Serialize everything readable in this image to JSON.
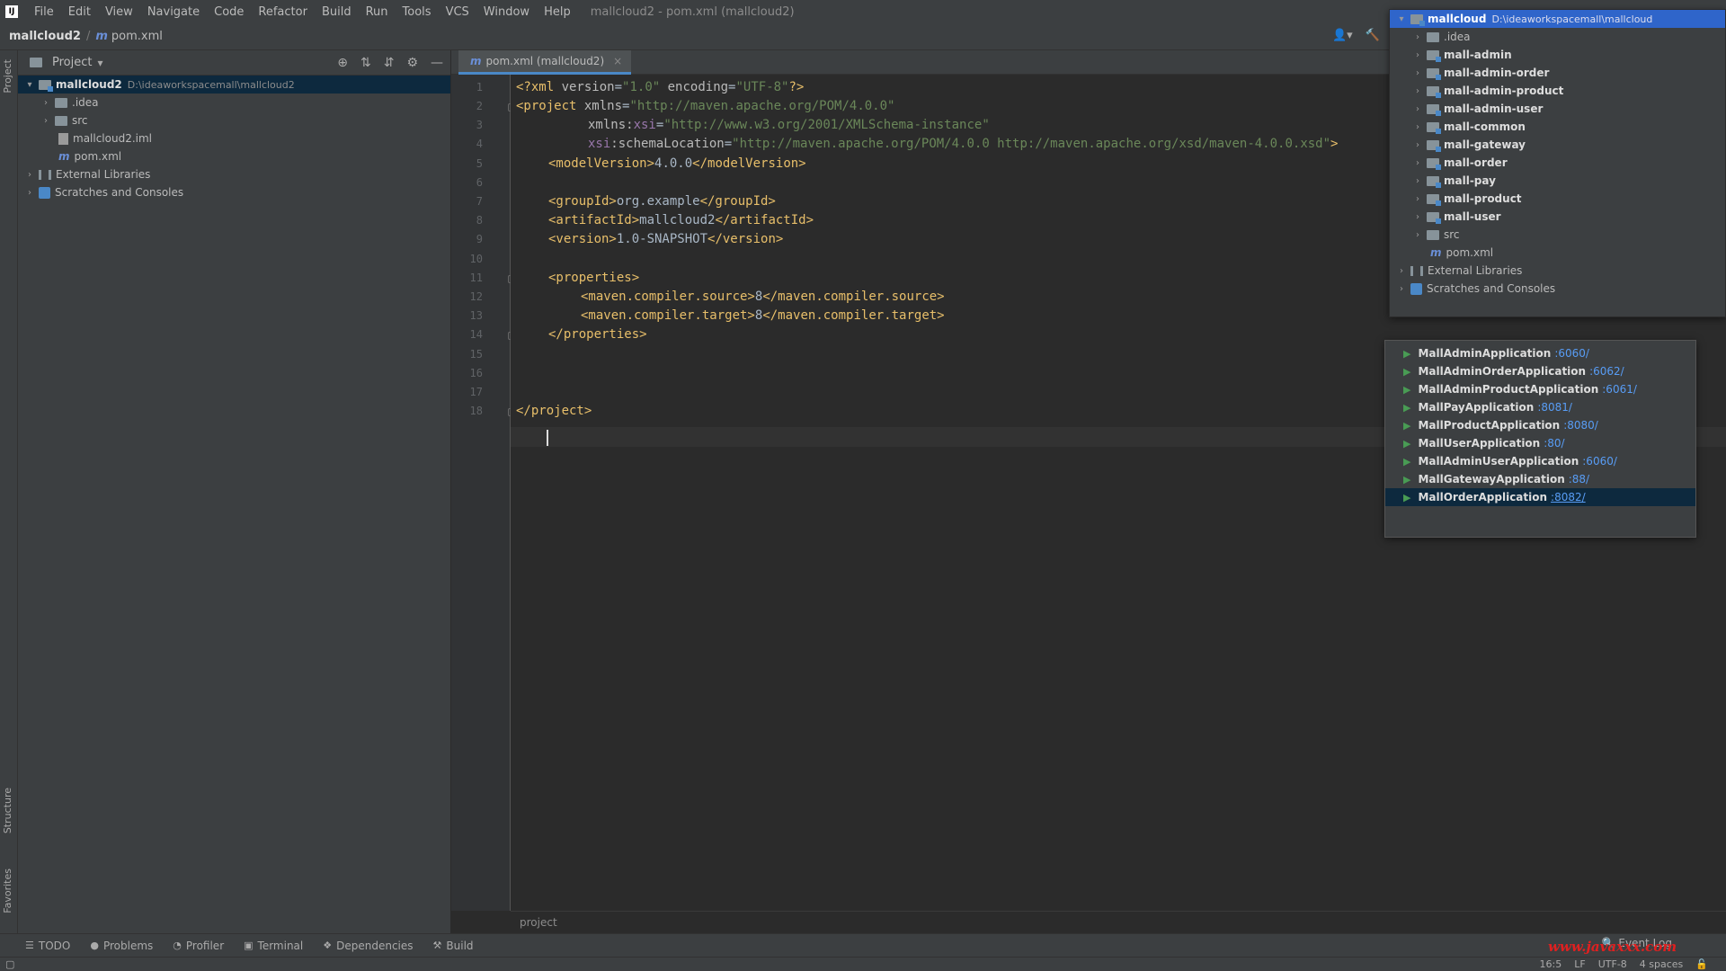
{
  "menubar": {
    "logo": "IJ",
    "items": [
      "File",
      "Edit",
      "View",
      "Navigate",
      "Code",
      "Refactor",
      "Build",
      "Run",
      "Tools",
      "VCS",
      "Window",
      "Help"
    ],
    "title": "mallcloud2 - pom.xml (mallcloud2)"
  },
  "navbar": {
    "project": "mallcloud2",
    "sep": "/",
    "file_icon": "m",
    "file": "pom.xml"
  },
  "left_strip": {
    "project": "Project",
    "structure": "Structure",
    "favorites": "Favorites"
  },
  "project_panel": {
    "title": "Project",
    "dropdown": "▾",
    "tree": [
      {
        "label": "mallcloud2",
        "hint": "D:\\ideaworkspacemall\\mallcloud2"
      },
      {
        "label": ".idea"
      },
      {
        "label": "src"
      },
      {
        "label": "mallcloud2.iml"
      },
      {
        "label": "pom.xml"
      },
      {
        "label": "External Libraries"
      },
      {
        "label": "Scratches and Consoles"
      }
    ]
  },
  "editor": {
    "tab_label": "pom.xml (mallcloud2)",
    "tab_close": "×",
    "line_numbers": [
      "1",
      "2",
      "3",
      "4",
      "5",
      "6",
      "7",
      "8",
      "9",
      "10",
      "11",
      "12",
      "13",
      "14",
      "15",
      "16",
      "17",
      "18"
    ],
    "lines": {
      "l1": {
        "a": "<?xml ",
        "b": "version",
        "c": "=",
        "d": "\"1.0\"",
        "e": " encoding",
        "f": "=",
        "g": "\"UTF-8\"",
        "h": "?>"
      },
      "l2": {
        "a": "<project ",
        "b": "xmlns",
        "c": "=",
        "d": "\"http://maven.apache.org/POM/4.0.0\""
      },
      "l3": {
        "a": "xmlns:",
        "b": "xsi",
        "c": "=",
        "d": "\"http://www.w3.org/2001/XMLSchema-instance\""
      },
      "l4": {
        "a": "xsi",
        "b": ":schemaLocation",
        "c": "=",
        "d": "\"http://maven.apache.org/POM/4.0.0 http://maven.apache.org/xsd/maven-4.0.0.xsd\"",
        "e": ">"
      },
      "l5": {
        "a": "<modelVersion>",
        "b": "4.0.0",
        "c": "</modelVersion>"
      },
      "l7": {
        "a": "<groupId>",
        "b": "org.example",
        "c": "</groupId>"
      },
      "l8": {
        "a": "<artifactId>",
        "b": "mallcloud2",
        "c": "</artifactId>"
      },
      "l9": {
        "a": "<version>",
        "b": "1.0-SNAPSHOT",
        "c": "</version>"
      },
      "l11": {
        "a": "<properties>"
      },
      "l12": {
        "a": "<maven.compiler.source>",
        "b": "8",
        "c": "</maven.compiler.source>"
      },
      "l13": {
        "a": "<maven.compiler.target>",
        "b": "8",
        "c": "</maven.compiler.target>"
      },
      "l14": {
        "a": "</properties>"
      },
      "l18": {
        "a": "</project>"
      }
    },
    "breadcrumb": "project"
  },
  "toolbar_right": {
    "user_icon": "user-icon",
    "build_icon": "hammer-icon"
  },
  "popup_tree": {
    "root": {
      "label": "mallcloud",
      "hint": "D:\\ideaworkspacemall\\mallcloud"
    },
    "items": [
      ".idea",
      "mall-admin",
      "mall-admin-order",
      "mall-admin-product",
      "mall-admin-user",
      "mall-common",
      "mall-gateway",
      "mall-order",
      "mall-pay",
      "mall-product",
      "mall-user",
      "src"
    ],
    "pom": "pom.xml",
    "external": "External Libraries",
    "scratches": "Scratches and Consoles"
  },
  "run_popup": {
    "items": [
      {
        "name": "MallAdminApplication",
        "port": ":6060/"
      },
      {
        "name": "MallAdminOrderApplication",
        "port": ":6062/"
      },
      {
        "name": "MallAdminProductApplication",
        "port": ":6061/"
      },
      {
        "name": "MallPayApplication",
        "port": ":8081/"
      },
      {
        "name": "MallProductApplication",
        "port": ":8080/"
      },
      {
        "name": "MallUserApplication",
        "port": ":80/"
      },
      {
        "name": "MallAdminUserApplication",
        "port": ":6060/"
      },
      {
        "name": "MallGatewayApplication",
        "port": ":88/"
      },
      {
        "name": "MallOrderApplication",
        "port": ":8082/"
      }
    ]
  },
  "bottom_bar": {
    "todo": "TODO",
    "problems": "Problems",
    "profiler": "Profiler",
    "terminal": "Terminal",
    "dependencies": "Dependencies",
    "build": "Build",
    "event_log": "Event Log"
  },
  "status": {
    "position": "16:5",
    "line_sep": "LF",
    "encoding": "UTF-8",
    "indent": "4 spaces"
  },
  "watermark": "www.javaxxx.com",
  "colors": {
    "accent": "#4a88c7",
    "selection": "#2f65ca",
    "run_green": "#499c54",
    "port_link": "#589df6"
  }
}
